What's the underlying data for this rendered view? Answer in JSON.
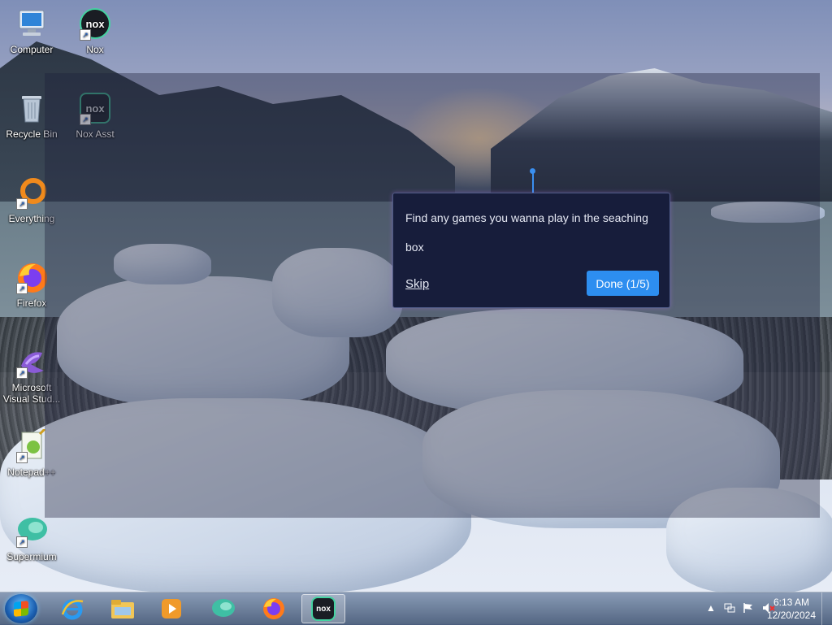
{
  "desktop": {
    "icons": [
      {
        "label": "Computer",
        "icon": "computer-icon"
      },
      {
        "label": "Nox",
        "icon": "nox-icon"
      },
      {
        "label": "Recycle Bin",
        "icon": "recycle-bin-icon"
      },
      {
        "label": "Nox Asst",
        "icon": "nox-assistant-icon"
      },
      {
        "label": "Everything",
        "icon": "everything-icon"
      },
      {
        "label": "Firefox",
        "icon": "firefox-icon"
      },
      {
        "label": "Microsoft Visual Stud...",
        "icon": "visual-studio-icon"
      },
      {
        "label": "Notepad++",
        "icon": "notepadpp-icon"
      },
      {
        "label": "Supermium",
        "icon": "supermium-icon"
      }
    ]
  },
  "tooltip": {
    "message": "Find any games you wanna play in the seaching box",
    "skip_label": "Skip",
    "done_label": "Done (1/5)"
  },
  "taskbar": {
    "items": [
      {
        "icon": "start-orb-icon"
      },
      {
        "icon": "internet-explorer-icon"
      },
      {
        "icon": "file-explorer-icon"
      },
      {
        "icon": "media-player-icon"
      },
      {
        "icon": "supermium-icon"
      },
      {
        "icon": "firefox-icon"
      },
      {
        "icon": "nox-icon",
        "active": true
      }
    ],
    "tray": {
      "time": "6:13 AM",
      "date": "12/20/2024",
      "icons": [
        "chevron-up-icon",
        "network-icon",
        "flag-icon",
        "volume-muted-icon"
      ]
    }
  },
  "colors": {
    "accent": "#2d8ef0",
    "tooltip_bg": "#171d3b",
    "nox_green": "#44d3a1"
  }
}
